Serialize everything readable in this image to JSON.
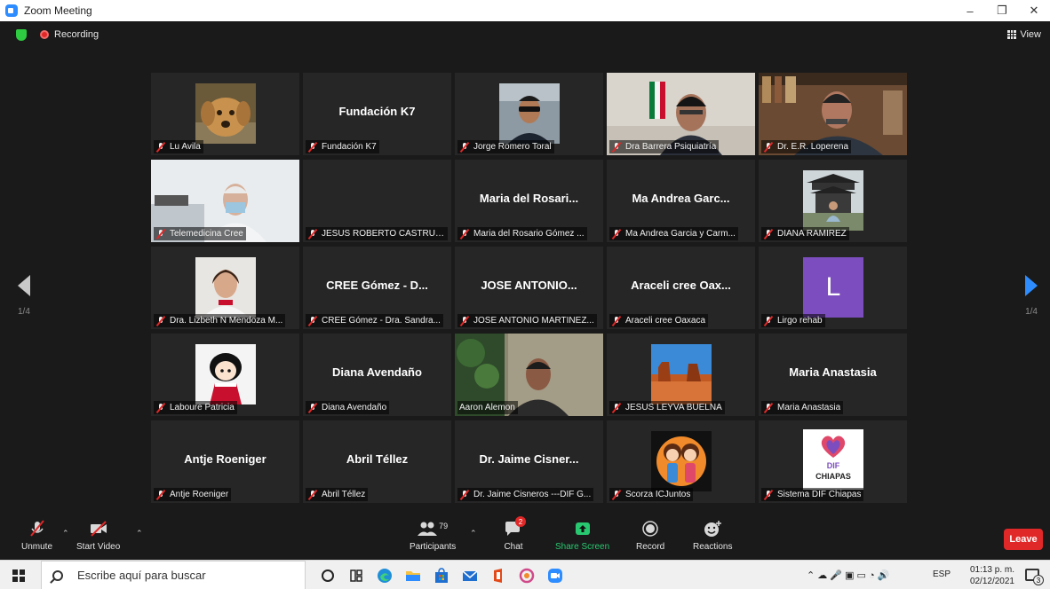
{
  "window": {
    "title": "Zoom Meeting",
    "controls": [
      "–",
      "❐",
      "✕"
    ]
  },
  "topbar": {
    "recording_label": "Recording",
    "view_label": "View"
  },
  "navigation": {
    "left_page": "1/4",
    "right_page": "1/4"
  },
  "participants_grid": [
    {
      "display_name": "",
      "label": "Lu Avila",
      "visual": "dog-photo",
      "muted": true
    },
    {
      "display_name": "Fundación K7",
      "label": "Fundación K7",
      "visual": "name",
      "muted": true
    },
    {
      "display_name": "",
      "label": "Jorge Romero Toral",
      "visual": "man-sunglasses-photo",
      "muted": true
    },
    {
      "display_name": "",
      "label": "Dra Barrera Psiquiatría",
      "visual": "video-office-flag",
      "muted": true
    },
    {
      "display_name": "",
      "label": "Dr. E.R. Loperena",
      "visual": "video-office-bookshelf",
      "muted": true
    },
    {
      "display_name": "",
      "label": "Telemedicina Cree",
      "visual": "video-doctor-masked",
      "muted": true
    },
    {
      "display_name": "",
      "label": "JESUS ROBERTO CASTRUIT...",
      "visual": "blank",
      "muted": true
    },
    {
      "display_name": "Maria del Rosari...",
      "label": "Maria del Rosario Gómez ...",
      "visual": "name",
      "muted": true
    },
    {
      "display_name": "Ma Andrea Garc...",
      "label": "Ma Andrea Garcia y Carm...",
      "visual": "name",
      "muted": true
    },
    {
      "display_name": "",
      "label": "DIANA RAMIREZ",
      "visual": "temple-photo",
      "muted": true
    },
    {
      "display_name": "",
      "label": "Dra. Lizbeth N Mendoza M...",
      "visual": "woman-photo",
      "muted": true
    },
    {
      "display_name": "CREE Gómez - D...",
      "label": "CREE Gómez - Dra. Sandra...",
      "visual": "name",
      "muted": true
    },
    {
      "display_name": "JOSE ANTONIO...",
      "label": "JOSE ANTONIO MARTINEZ...",
      "visual": "name",
      "muted": true
    },
    {
      "display_name": "Araceli cree Oax...",
      "label": "Araceli cree Oaxaca",
      "visual": "name",
      "muted": true
    },
    {
      "display_name": "",
      "label": "Lirgo rehab",
      "visual": "letter-avatar",
      "avatar_letter": "L",
      "avatar_color": "#7c4dbe",
      "muted": true
    },
    {
      "display_name": "",
      "label": "Laboure Patricia",
      "visual": "cartoon-girl",
      "muted": true
    },
    {
      "display_name": "Diana Avendaño",
      "label": "Diana Avendaño",
      "visual": "name",
      "muted": true
    },
    {
      "display_name": "",
      "label": "Aaron Alemon",
      "visual": "video-man-speaking",
      "muted": false,
      "active_speaker": true
    },
    {
      "display_name": "",
      "label": "JESUS LEYVA BUELNA",
      "visual": "desert-photo",
      "muted": true
    },
    {
      "display_name": "Maria Anastasia",
      "label": "Maria Anastasia",
      "visual": "name",
      "muted": true
    },
    {
      "display_name": "Antje Roeniger",
      "label": "Antje Roeniger",
      "visual": "name",
      "muted": true
    },
    {
      "display_name": "Abril Téllez",
      "label": "Abril Téllez",
      "visual": "name",
      "muted": true
    },
    {
      "display_name": "Dr. Jaime Cisner...",
      "label": "Dr. Jaime Cisneros ---DIF G...",
      "visual": "name",
      "muted": true
    },
    {
      "display_name": "",
      "label": "Scorza ICJuntos",
      "visual": "cartoon-couple",
      "muted": true
    },
    {
      "display_name": "",
      "label": "Sistema DIF Chiapas",
      "visual": "dif-logo",
      "logo_text": "DIF",
      "logo_subtext": "CHIAPAS",
      "muted": true
    }
  ],
  "toolbar": {
    "unmute": "Unmute",
    "start_video": "Start Video",
    "participants": "Participants",
    "participants_count": "79",
    "chat": "Chat",
    "chat_badge": "2",
    "share_screen": "Share Screen",
    "record": "Record",
    "reactions": "Reactions",
    "leave": "Leave"
  },
  "taskbar": {
    "search_placeholder": "Escribe aquí para buscar",
    "language": "ESP",
    "time": "01:13 p. m.",
    "date": "02/12/2021",
    "notification_count": "3"
  },
  "colors": {
    "accent_blue": "#2d8cff",
    "leave_red": "#e02828",
    "share_green": "#28c870",
    "active_speaker": "#dfe36a"
  }
}
